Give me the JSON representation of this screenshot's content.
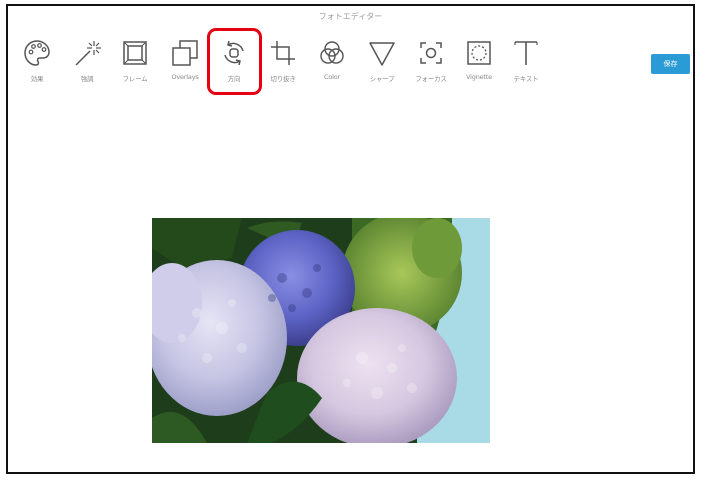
{
  "window": {
    "title": "フォトエディター"
  },
  "toolbar": {
    "tools": [
      {
        "label": "効果",
        "icon": "palette-icon"
      },
      {
        "label": "強調",
        "icon": "magic-wand-icon"
      },
      {
        "label": "フレーム",
        "icon": "frame-icon"
      },
      {
        "label": "Overlays",
        "icon": "overlays-icon"
      },
      {
        "label": "方向",
        "icon": "rotate-icon"
      },
      {
        "label": "切り抜き",
        "icon": "crop-icon"
      },
      {
        "label": "Color",
        "icon": "color-circles-icon"
      },
      {
        "label": "シャープ",
        "icon": "sharpen-triangle-icon"
      },
      {
        "label": "フォーカス",
        "icon": "focus-icon"
      },
      {
        "label": "Vignette",
        "icon": "vignette-icon"
      },
      {
        "label": "テキスト",
        "icon": "text-icon"
      }
    ],
    "save_label": "保存"
  },
  "highlight": {
    "tool": "方向",
    "color": "#e50012"
  },
  "colors": {
    "save_button": "#2b9bd6",
    "highlight": "#e50012",
    "toolbar_border": "#dcdcdc"
  }
}
